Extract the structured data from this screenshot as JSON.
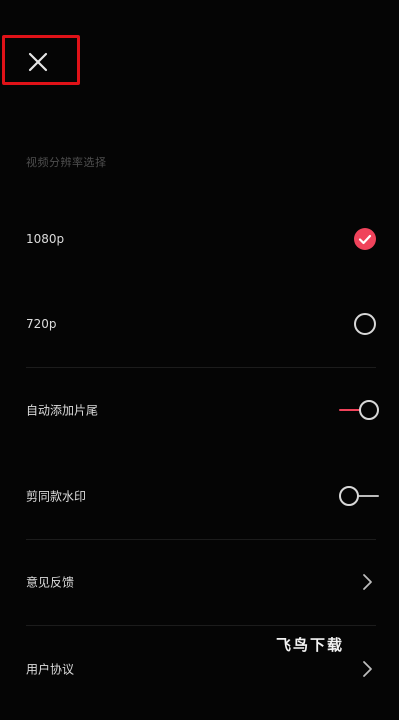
{
  "header": {
    "close_icon": "close-icon",
    "highlight_color": "#e01218"
  },
  "resolution": {
    "section_title": "视频分辨率选择",
    "options": [
      {
        "label": "1080p",
        "selected": true
      },
      {
        "label": "720p",
        "selected": false
      }
    ],
    "accent_color": "#f0435b"
  },
  "toggles": [
    {
      "label": "自动添加片尾",
      "on": true
    },
    {
      "label": "剪同款水印",
      "on": false
    }
  ],
  "links": [
    {
      "label": "意见反馈",
      "icon": "chevron-right-icon"
    },
    {
      "label": "用户协议",
      "icon": "chevron-right-icon"
    }
  ],
  "watermark": "飞鸟下载"
}
